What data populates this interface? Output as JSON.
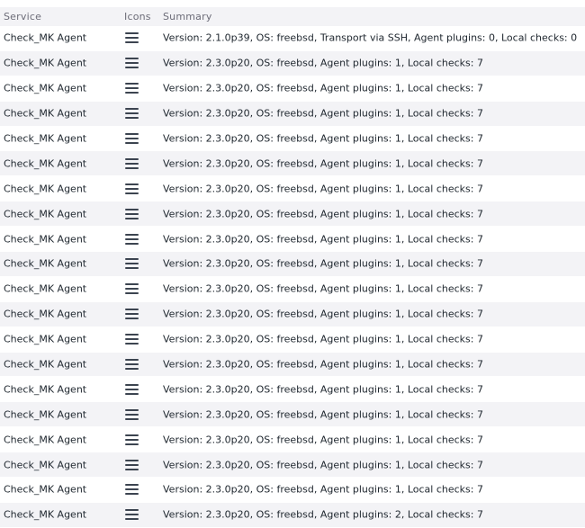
{
  "table": {
    "headers": {
      "service": "Service",
      "icons": "Icons",
      "summary": "Summary"
    },
    "rows": [
      {
        "service": "Check_MK Agent",
        "icon": "menu-icon",
        "summary": "Version: 2.1.0p39, OS: freebsd, Transport via SSH, Agent plugins: 0, Local checks: 0"
      },
      {
        "service": "Check_MK Agent",
        "icon": "menu-icon",
        "summary": "Version: 2.3.0p20, OS: freebsd, Agent plugins: 1, Local checks: 7"
      },
      {
        "service": "Check_MK Agent",
        "icon": "menu-icon",
        "summary": "Version: 2.3.0p20, OS: freebsd, Agent plugins: 1, Local checks: 7"
      },
      {
        "service": "Check_MK Agent",
        "icon": "menu-icon",
        "summary": "Version: 2.3.0p20, OS: freebsd, Agent plugins: 1, Local checks: 7"
      },
      {
        "service": "Check_MK Agent",
        "icon": "menu-icon",
        "summary": "Version: 2.3.0p20, OS: freebsd, Agent plugins: 1, Local checks: 7"
      },
      {
        "service": "Check_MK Agent",
        "icon": "menu-icon",
        "summary": "Version: 2.3.0p20, OS: freebsd, Agent plugins: 1, Local checks: 7"
      },
      {
        "service": "Check_MK Agent",
        "icon": "menu-icon",
        "summary": "Version: 2.3.0p20, OS: freebsd, Agent plugins: 1, Local checks: 7"
      },
      {
        "service": "Check_MK Agent",
        "icon": "menu-icon",
        "summary": "Version: 2.3.0p20, OS: freebsd, Agent plugins: 1, Local checks: 7"
      },
      {
        "service": "Check_MK Agent",
        "icon": "menu-icon",
        "summary": "Version: 2.3.0p20, OS: freebsd, Agent plugins: 1, Local checks: 7"
      },
      {
        "service": "Check_MK Agent",
        "icon": "menu-icon",
        "summary": "Version: 2.3.0p20, OS: freebsd, Agent plugins: 1, Local checks: 7"
      },
      {
        "service": "Check_MK Agent",
        "icon": "menu-icon",
        "summary": "Version: 2.3.0p20, OS: freebsd, Agent plugins: 1, Local checks: 7"
      },
      {
        "service": "Check_MK Agent",
        "icon": "menu-icon",
        "summary": "Version: 2.3.0p20, OS: freebsd, Agent plugins: 1, Local checks: 7"
      },
      {
        "service": "Check_MK Agent",
        "icon": "menu-icon",
        "summary": "Version: 2.3.0p20, OS: freebsd, Agent plugins: 1, Local checks: 7"
      },
      {
        "service": "Check_MK Agent",
        "icon": "menu-icon",
        "summary": "Version: 2.3.0p20, OS: freebsd, Agent plugins: 1, Local checks: 7"
      },
      {
        "service": "Check_MK Agent",
        "icon": "menu-icon",
        "summary": "Version: 2.3.0p20, OS: freebsd, Agent plugins: 1, Local checks: 7"
      },
      {
        "service": "Check_MK Agent",
        "icon": "menu-icon",
        "summary": "Version: 2.3.0p20, OS: freebsd, Agent plugins: 1, Local checks: 7"
      },
      {
        "service": "Check_MK Agent",
        "icon": "menu-icon",
        "summary": "Version: 2.3.0p20, OS: freebsd, Agent plugins: 1, Local checks: 7"
      },
      {
        "service": "Check_MK Agent",
        "icon": "menu-icon",
        "summary": "Version: 2.3.0p20, OS: freebsd, Agent plugins: 1, Local checks: 7"
      },
      {
        "service": "Check_MK Agent",
        "icon": "menu-icon",
        "summary": "Version: 2.3.0p20, OS: freebsd, Agent plugins: 1, Local checks: 7"
      },
      {
        "service": "Check_MK Agent",
        "icon": "menu-icon",
        "summary": "Version: 2.3.0p20, OS: freebsd, Agent plugins: 2, Local checks: 7"
      }
    ]
  }
}
